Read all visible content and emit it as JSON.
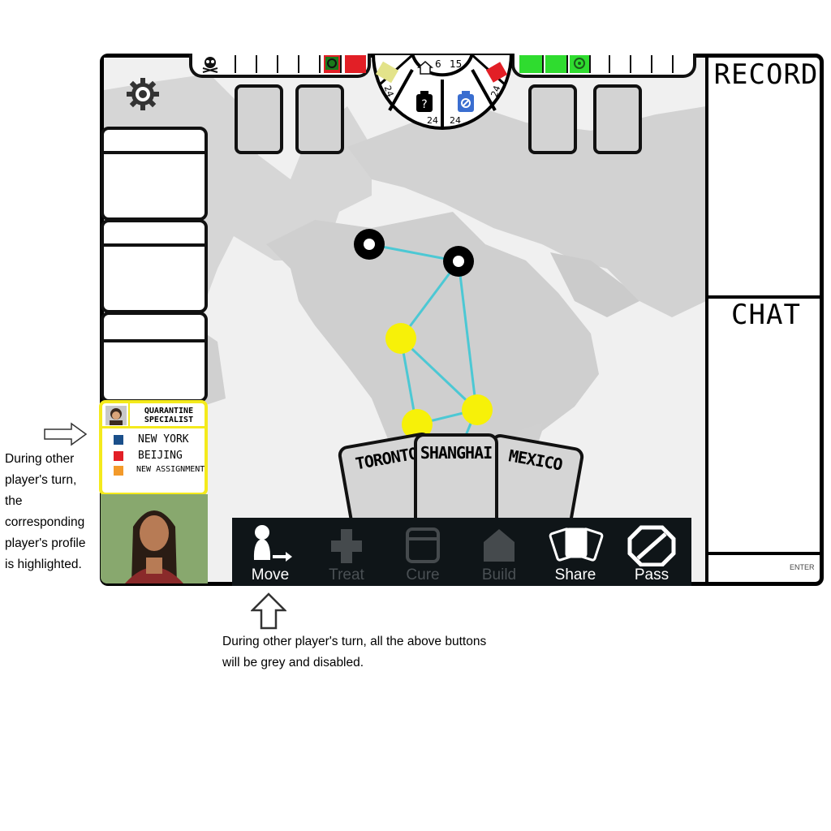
{
  "right_panel": {
    "record_title": "RECORD",
    "chat_title": "CHAT",
    "enter_button": "ENTER"
  },
  "disease_wheel": {
    "research_station_count": "6",
    "outbreak_count": "15",
    "cube_counts": [
      "24",
      "24",
      "24",
      "24"
    ]
  },
  "player": {
    "role": "QUARANTINE SPECIALIST",
    "cards": [
      {
        "label": "NEW YORK",
        "color": "#1a4f8a"
      },
      {
        "label": "BEIJING",
        "color": "#e21f26"
      },
      {
        "label": "NEW ASSIGNMENT",
        "color": "#f39a2a"
      }
    ]
  },
  "city_cards": [
    "TORONTO",
    "SHANGHAI",
    "MEXICO"
  ],
  "actions": [
    {
      "label": "Move",
      "enabled": true
    },
    {
      "label": "Treat",
      "enabled": false
    },
    {
      "label": "Cure",
      "enabled": false
    },
    {
      "label": "Build",
      "enabled": false
    },
    {
      "label": "Share",
      "enabled": true
    },
    {
      "label": "Pass",
      "enabled": true
    }
  ],
  "annotations": {
    "profile_note": [
      "During other",
      "player's turn,",
      "the",
      "corresponding",
      "player's profile",
      "is highlighted."
    ],
    "buttons_note": [
      "During other player's turn, all the above buttons",
      "will be grey and disabled."
    ]
  },
  "colors": {
    "highlight": "#f4ea1c",
    "infection_red": "#e21f26",
    "cure_green": "#2fdc2f",
    "node_yellow": "#f7f108",
    "route": "#4cc8d4"
  },
  "icons": [
    "gear-icon",
    "skull-icon",
    "biohazard-icon",
    "house-icon",
    "question-icon",
    "vial-icon",
    "arrow-right-icon",
    "arrow-up-icon"
  ]
}
